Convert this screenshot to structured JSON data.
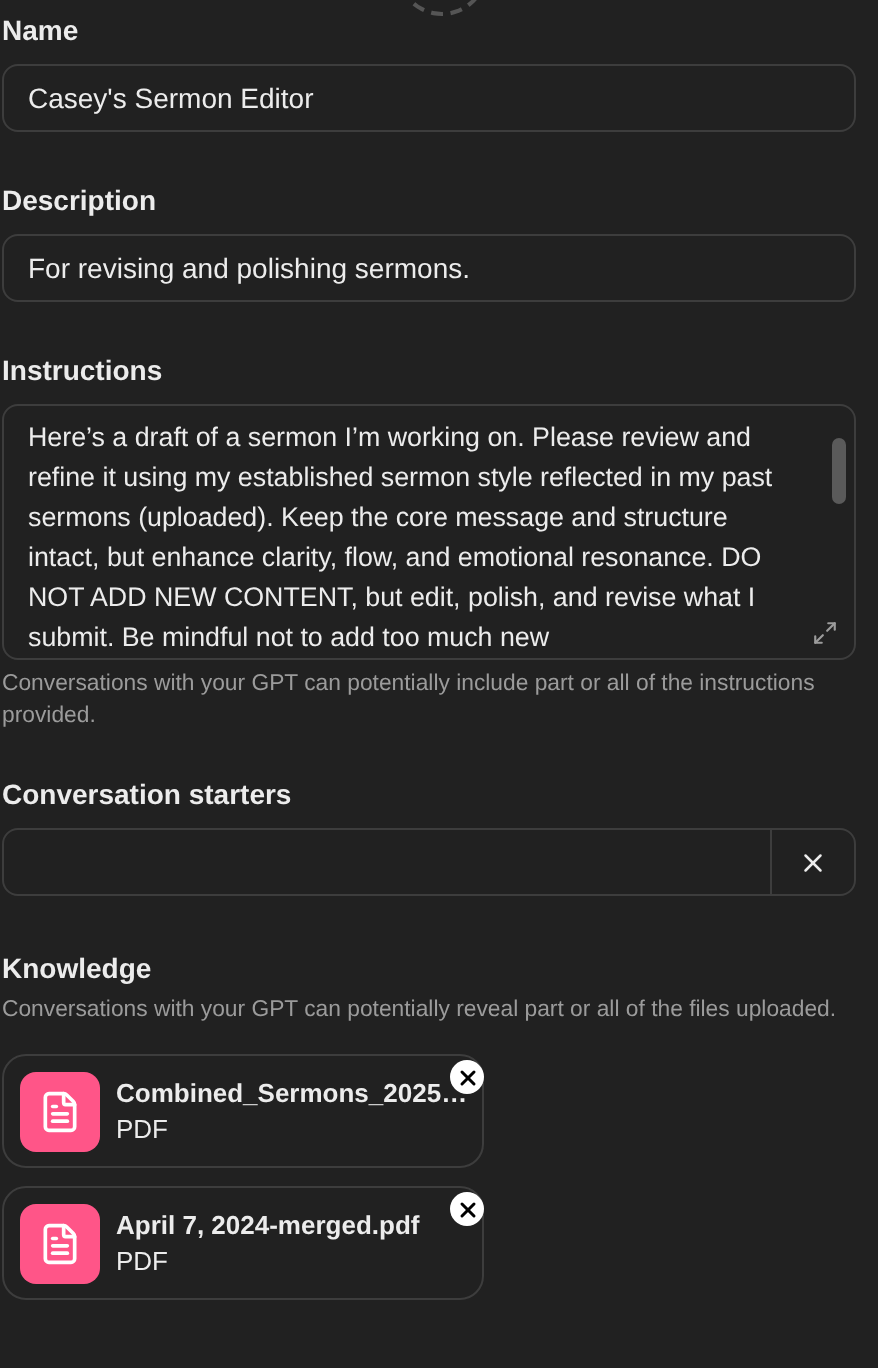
{
  "name": {
    "label": "Name",
    "value": "Casey's Sermon Editor"
  },
  "description": {
    "label": "Description",
    "value": "For revising and polishing sermons."
  },
  "instructions": {
    "label": "Instructions",
    "value": "Here’s a draft of a sermon I’m working on. Please review and refine it using my established sermon style reflected in my past sermons (uploaded). Keep the core message and structure intact, but enhance clarity, flow, and emotional resonance. DO NOT ADD NEW CONTENT, but edit, polish, and revise what I submit. Be mindful not to add too much new",
    "hint": "Conversations with your GPT can potentially include part or all of the instructions provided."
  },
  "conversation_starters": {
    "label": "Conversation starters"
  },
  "knowledge": {
    "label": "Knowledge",
    "hint": "Conversations with your GPT can potentially reveal part or all of the files uploaded.",
    "files": [
      {
        "name": "Combined_Sermons_2025…",
        "type": "PDF"
      },
      {
        "name": "April 7, 2024-merged.pdf",
        "type": "PDF"
      }
    ]
  }
}
